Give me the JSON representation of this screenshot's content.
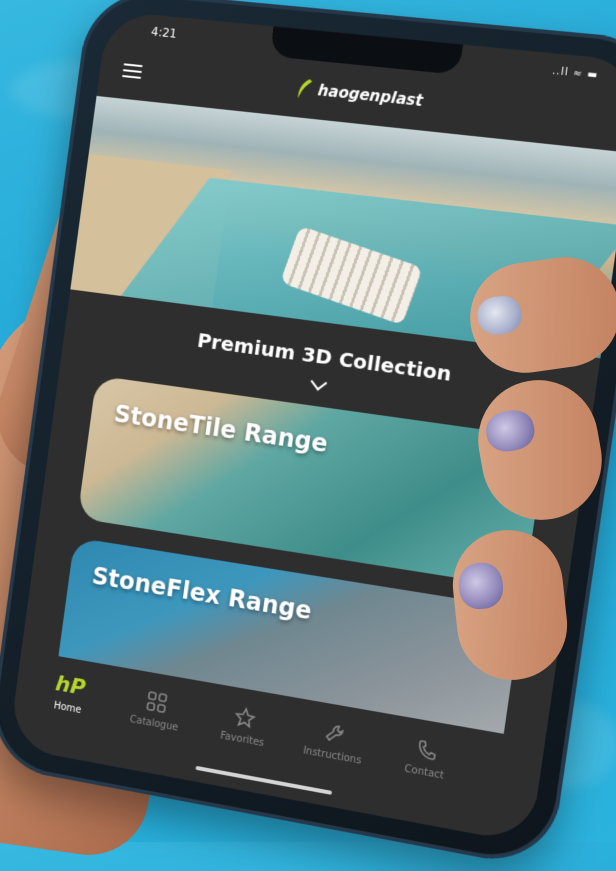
{
  "status": {
    "time": "4:21",
    "signal": "..ll ≈ ▬"
  },
  "header": {
    "brand": "haogenplast",
    "brand_color": "#b7d62c"
  },
  "hero": {
    "image": "pool-with-lounger"
  },
  "collection": {
    "title": "Premium 3D Collection"
  },
  "ranges": [
    {
      "label": "StoneTile Range"
    },
    {
      "label": "StoneFlex Range"
    }
  ],
  "tabs": [
    {
      "label": "Home",
      "icon": "hp-logo"
    },
    {
      "label": "Catalogue",
      "icon": "grid-icon"
    },
    {
      "label": "Favorites",
      "icon": "star-icon"
    },
    {
      "label": "Instructions",
      "icon": "wrench-icon"
    },
    {
      "label": "Contact",
      "icon": "phone-icon"
    }
  ],
  "home_logo_text": "hP"
}
